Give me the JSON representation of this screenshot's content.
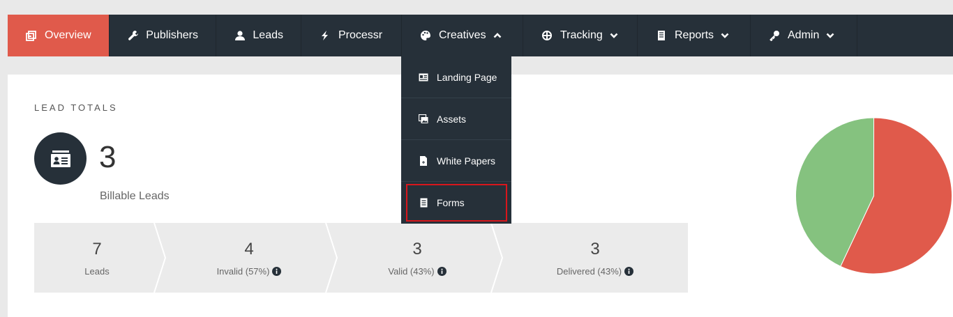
{
  "nav": {
    "items": [
      {
        "label": "Overview",
        "icon": "dashboard-icon",
        "active": true
      },
      {
        "label": "Publishers",
        "icon": "wrench-icon"
      },
      {
        "label": "Leads",
        "icon": "user-icon"
      },
      {
        "label": "Processr",
        "icon": "bolt-icon"
      },
      {
        "label": "Creatives",
        "icon": "palette-icon",
        "expanded": true
      },
      {
        "label": "Tracking",
        "icon": "crosshairs-icon"
      },
      {
        "label": "Reports",
        "icon": "report-icon"
      },
      {
        "label": "Admin",
        "icon": "key-icon"
      }
    ]
  },
  "creatives_menu": {
    "items": [
      {
        "label": "Landing Page",
        "icon": "id-card-icon"
      },
      {
        "label": "Assets",
        "icon": "images-icon"
      },
      {
        "label": "White Papers",
        "icon": "file-icon"
      },
      {
        "label": "Forms",
        "icon": "form-icon",
        "highlighted": true
      }
    ]
  },
  "lead_totals": {
    "title": "LEAD TOTALS",
    "count": "3",
    "count_label": "Billable Leads"
  },
  "stats": [
    {
      "value": "7",
      "label": "Leads",
      "info": false
    },
    {
      "value": "4",
      "label": "Invalid (57%)",
      "info": true
    },
    {
      "value": "3",
      "label": "Valid (43%)",
      "info": true
    },
    {
      "value": "3",
      "label": "Delivered (43%)",
      "info": true
    }
  ],
  "chart_data": {
    "type": "pie",
    "values": [
      57,
      43
    ],
    "colors": [
      "#e05a4b",
      "#85c27f"
    ]
  },
  "colors": {
    "nav_bg": "#263039",
    "active": "#e05a4b",
    "pie_red": "#e05a4b",
    "pie_green": "#85c27f",
    "highlight": "#d9161c"
  }
}
